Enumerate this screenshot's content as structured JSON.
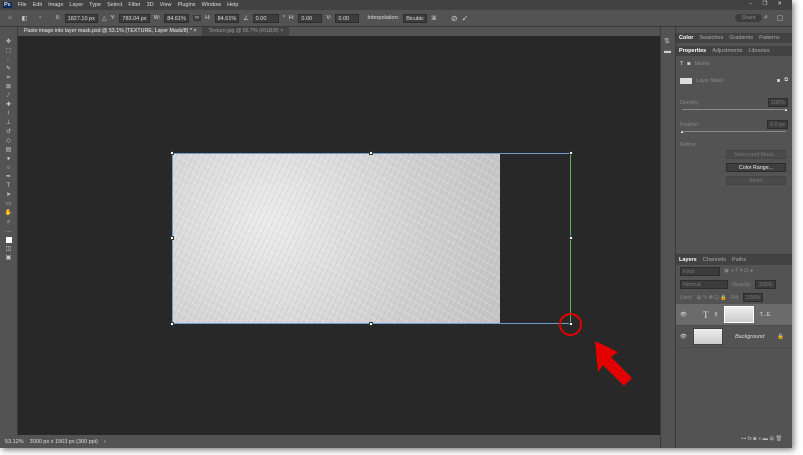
{
  "menu": {
    "logo": "Ps",
    "items": [
      "File",
      "Edit",
      "Image",
      "Layer",
      "Type",
      "Select",
      "Filter",
      "3D",
      "View",
      "Plugins",
      "Window",
      "Help"
    ]
  },
  "options": {
    "x_label": "X:",
    "x": "1827.10 px",
    "y_label": "Y:",
    "y": "783.04 px",
    "w_label": "W:",
    "w": "84.61%",
    "h_label": "H:",
    "h": "84.61%",
    "angle": "0.00",
    "deg": "°",
    "hskew_label": "H:",
    "hskew": "0.00",
    "vskew_label": "V:",
    "vskew": "0.00",
    "interp_label": "Interpolation:",
    "interp": "Bicubic",
    "share": "Share"
  },
  "tabs": [
    {
      "label": "Paste image into layer mask.psd @ 53.1% (TEXTURE, Layer Mask/8) *",
      "close": "×"
    },
    {
      "label": "Texture.jpg @ 66.7% (RGB/8)",
      "close": "×"
    }
  ],
  "status": {
    "zoom": "53.12%",
    "doc": "3000 px x 1563 px (300 ppi)",
    "more": "›"
  },
  "color_panel": {
    "tabs": [
      "Color",
      "Swatches",
      "Gradients",
      "Patterns"
    ]
  },
  "properties": {
    "tabs": [
      "Properties",
      "Adjustments",
      "Libraries"
    ],
    "masks_label": "Masks",
    "layer_mask": "Layer Mask",
    "density_label": "Density:",
    "density": "100%",
    "feather_label": "Feather:",
    "feather": "0.0 px",
    "refine_label": "Refine:",
    "select_mask": "Select and Mask...",
    "color_range": "Color Range...",
    "invert": "Invert"
  },
  "layers": {
    "tabs": [
      "Layers",
      "Channels",
      "Paths"
    ],
    "kind": "Kind",
    "blend": "Normal",
    "opacity_label": "Opacity:",
    "opacity": "100%",
    "lock_label": "Lock:",
    "fill_label": "Fill:",
    "fill": "100%",
    "items": [
      {
        "name": "T...E",
        "type": "T"
      },
      {
        "name": "Background",
        "lock": "🔒"
      }
    ]
  }
}
